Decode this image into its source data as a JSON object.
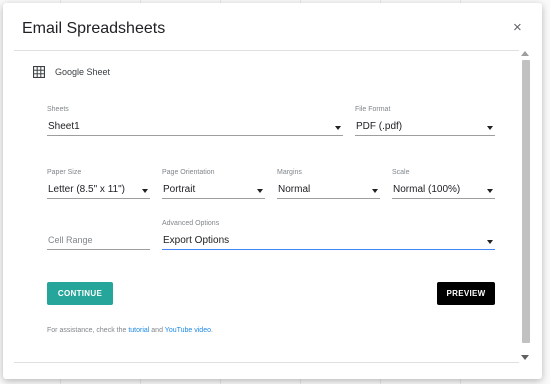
{
  "dialog": {
    "title": "Email Spreadsheets",
    "close_label": "×"
  },
  "sheet": {
    "name": "Google Sheet"
  },
  "fields": {
    "sheets": {
      "label": "Sheets",
      "value": "Sheet1"
    },
    "file_format": {
      "label": "File Format",
      "value": "PDF (.pdf)"
    },
    "paper_size": {
      "label": "Paper Size",
      "value": "Letter (8.5\" x 11\")"
    },
    "page_orientation": {
      "label": "Page Orientation",
      "value": "Portrait"
    },
    "margins": {
      "label": "Margins",
      "value": "Normal"
    },
    "scale": {
      "label": "Scale",
      "value": "Normal (100%)"
    },
    "cell_range": {
      "placeholder": "Cell Range"
    },
    "advanced_options": {
      "label": "Advanced Options",
      "value": "Export Options"
    }
  },
  "buttons": {
    "continue": "CONTINUE",
    "preview": "PREVIEW"
  },
  "help": {
    "prefix": "For assistance, check the ",
    "tutorial_link": "tutorial",
    "middle": " and ",
    "youtube_link": "YouTube video",
    "suffix": "."
  },
  "colors": {
    "accent": "#26a69a",
    "link": "#1e88e5",
    "active_underline": "#4285f4"
  },
  "icons": {
    "sheet": "grid-icon",
    "close": "close-icon"
  }
}
